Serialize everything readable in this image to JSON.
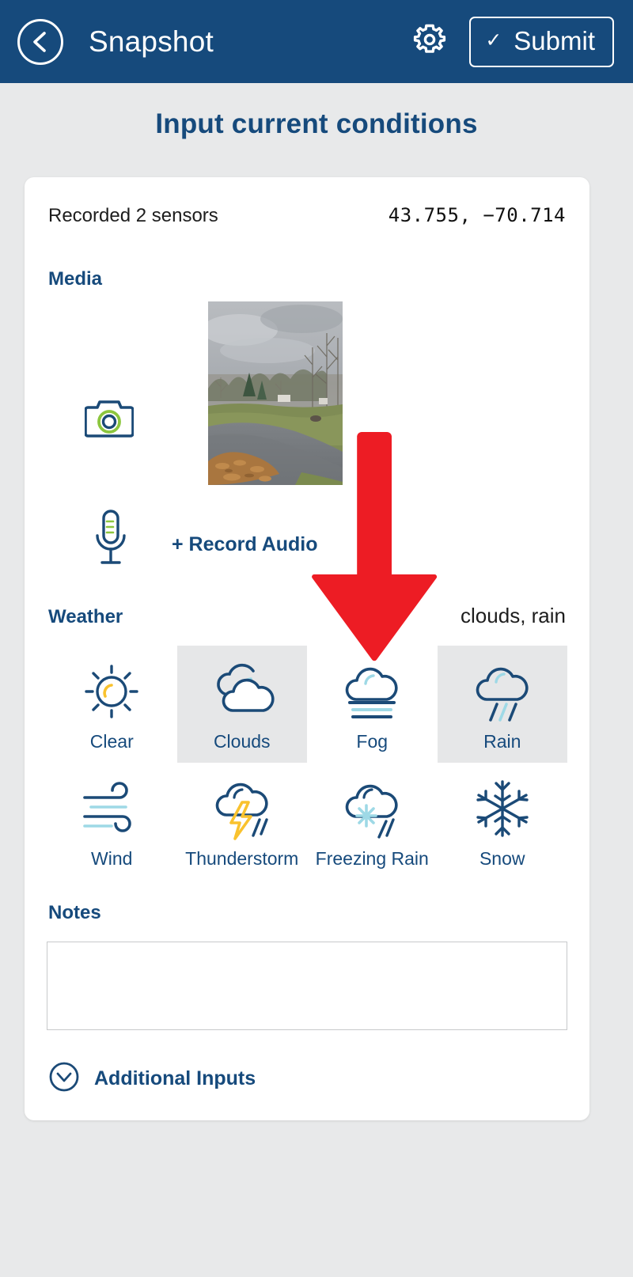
{
  "header": {
    "back_icon": "chevron-left-circle-icon",
    "title": "Snapshot",
    "gear_icon": "gear-icon",
    "submit_check": "✓",
    "submit_label": "Submit",
    "background_color": "#164a7c"
  },
  "page": {
    "title": "Input current conditions",
    "background_color": "#e8e9ea",
    "accent_color": "#164a7c",
    "accent_green": "#8cc63e",
    "accent_yellow": "#f9c22e",
    "accent_lightblue": "#9ed9e6",
    "selected_tile_color": "#e6e7e8"
  },
  "card": {
    "sensors_text": "Recorded 2 sensors",
    "coordinates": "43.755, −70.714"
  },
  "media": {
    "label": "Media",
    "camera_icon": "camera-icon",
    "photo_alt": "outdoor landscape photo with overcast sky, bare trees, wet driveway and fallen leaves",
    "mic_icon": "microphone-icon",
    "record_audio_label": "+ Record Audio"
  },
  "weather": {
    "label": "Weather",
    "value": "clouds, rain",
    "options": [
      {
        "id": "clear",
        "label": "Clear",
        "icon": "sun-icon",
        "selected": false
      },
      {
        "id": "clouds",
        "label": "Clouds",
        "icon": "cloud-icon",
        "selected": true
      },
      {
        "id": "fog",
        "label": "Fog",
        "icon": "fog-icon",
        "selected": false
      },
      {
        "id": "rain",
        "label": "Rain",
        "icon": "rain-cloud-icon",
        "selected": true
      },
      {
        "id": "wind",
        "label": "Wind",
        "icon": "wind-icon",
        "selected": false
      },
      {
        "id": "thunderstorm",
        "label": "Thunderstorm",
        "icon": "thunderstorm-icon",
        "selected": false
      },
      {
        "id": "freezing-rain",
        "label": "Freezing Rain",
        "icon": "freezing-rain-icon",
        "selected": false
      },
      {
        "id": "snow",
        "label": "Snow",
        "icon": "snowflake-icon",
        "selected": false
      }
    ]
  },
  "notes": {
    "label": "Notes",
    "value": "",
    "placeholder": ""
  },
  "additional": {
    "icon": "chevron-down-circle-icon",
    "label": "Additional Inputs"
  },
  "annotation": {
    "arrow_icon": "red-down-arrow-annotation",
    "color": "#ed1c24",
    "points_at": "fog"
  }
}
